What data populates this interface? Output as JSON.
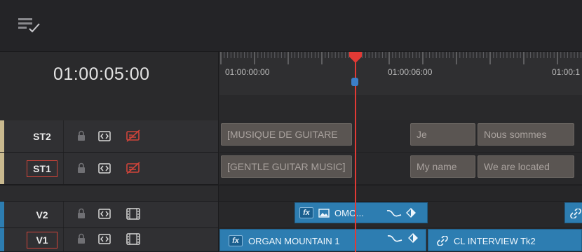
{
  "toolbar": {
    "icon": "timeline-view-options-icon"
  },
  "timecode": "01:00:05:00",
  "ruler": {
    "labels": [
      "01:00:00:00",
      "01:00:06:00",
      "01:00:1"
    ]
  },
  "tracks": {
    "st2": {
      "name": "ST2",
      "clips": [
        "[MUSIQUE DE GUITARE",
        "Je",
        "Nous sommes"
      ]
    },
    "st1": {
      "name": "ST1",
      "clips": [
        "[GENTLE GUITAR MUSIC]",
        "My name",
        "We are located"
      ]
    },
    "v2": {
      "name": "V2",
      "clips": [
        "OMO..."
      ]
    },
    "v1": {
      "name": "V1",
      "clips": [
        "ORGAN MOUNTAIN 1",
        "CL INTERVIEW Tk2"
      ]
    }
  },
  "fx_label": "fx",
  "colors": {
    "playhead": "#e23a35",
    "video_clip": "#2d7db1",
    "subtitle_clip": "#5a5552",
    "track_outline": "#d0443a",
    "subtitle_accent": "#c9b98f",
    "video_accent": "#2d7db1"
  }
}
